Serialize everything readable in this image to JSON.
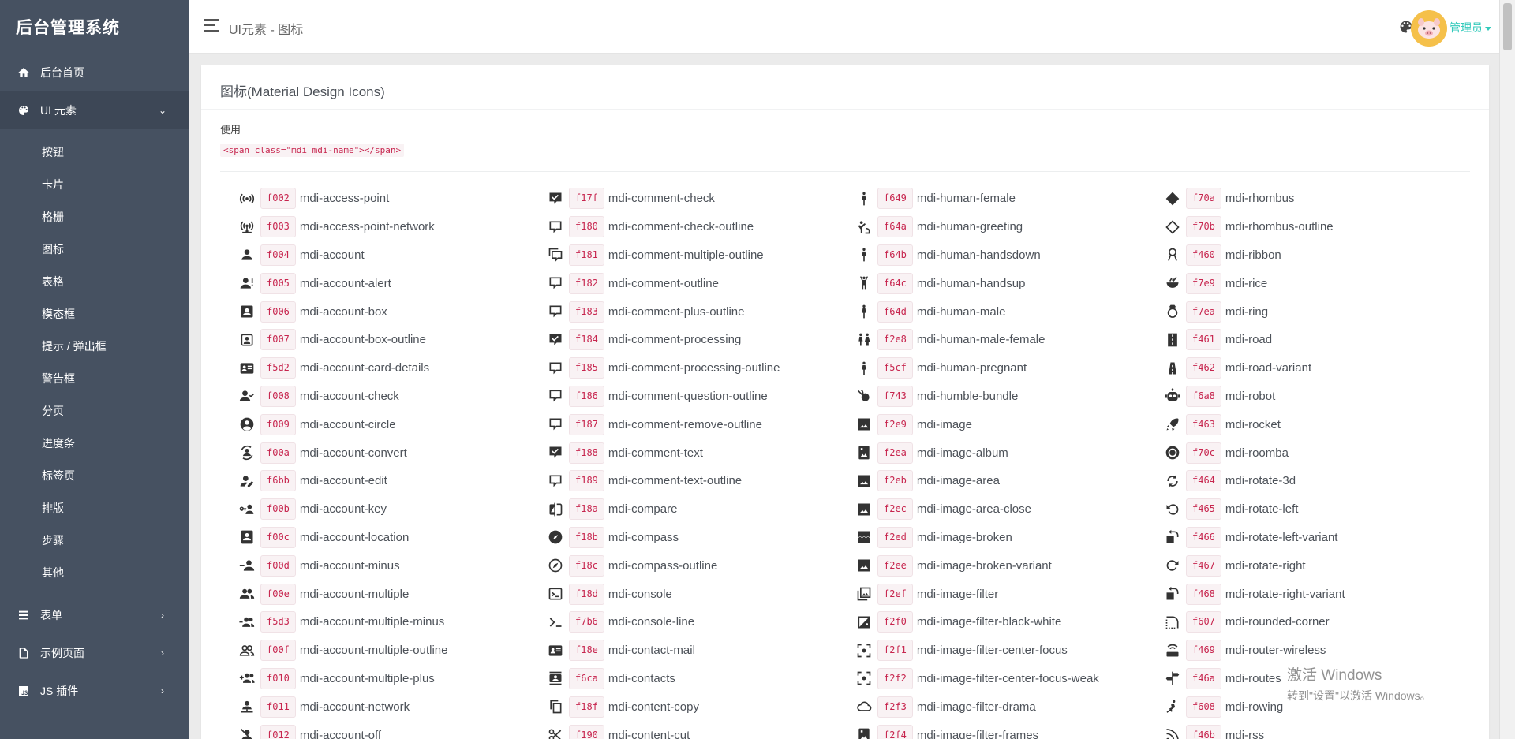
{
  "app": {
    "title": "后台管理系统"
  },
  "sidebar": {
    "top_items": [
      {
        "label": "后台首页",
        "icon": "home-icon"
      },
      {
        "label": "UI 元素",
        "icon": "palette-icon"
      }
    ],
    "sub_items": [
      "按钮",
      "卡片",
      "格栅",
      "图标",
      "表格",
      "模态框",
      "提示 / 弹出框",
      "警告框",
      "分页",
      "进度条",
      "标签页",
      "排版",
      "步骤",
      "其他"
    ],
    "bottom_items": [
      {
        "label": "表单",
        "icon": "format-list-icon"
      },
      {
        "label": "示例页面",
        "icon": "file-outline-icon"
      },
      {
        "label": "JS 插件",
        "icon": "language-javascript-icon"
      }
    ]
  },
  "header": {
    "title": "UI元素 - 图标",
    "user": "管理员"
  },
  "card": {
    "title": "图标(Material Design Icons)",
    "usage_label": "使用",
    "usage_code": "<span class=\"mdi mdi-name\"></span>"
  },
  "icon_columns": [
    [
      {
        "code": "f002",
        "name": "mdi-access-point",
        "g": "ap"
      },
      {
        "code": "f003",
        "name": "mdi-access-point-network",
        "g": "apn"
      },
      {
        "code": "f004",
        "name": "mdi-account",
        "g": "acc"
      },
      {
        "code": "f005",
        "name": "mdi-account-alert",
        "g": "acca"
      },
      {
        "code": "f006",
        "name": "mdi-account-box",
        "g": "accb"
      },
      {
        "code": "f007",
        "name": "mdi-account-box-outline",
        "g": "accbo"
      },
      {
        "code": "f5d2",
        "name": "mdi-account-card-details",
        "g": "card"
      },
      {
        "code": "f008",
        "name": "mdi-account-check",
        "g": "accc"
      },
      {
        "code": "f009",
        "name": "mdi-account-circle",
        "g": "accci"
      },
      {
        "code": "f00a",
        "name": "mdi-account-convert",
        "g": "conv"
      },
      {
        "code": "f6bb",
        "name": "mdi-account-edit",
        "g": "acce"
      },
      {
        "code": "f00b",
        "name": "mdi-account-key",
        "g": "acck"
      },
      {
        "code": "f00c",
        "name": "mdi-account-location",
        "g": "accl"
      },
      {
        "code": "f00d",
        "name": "mdi-account-minus",
        "g": "accm"
      },
      {
        "code": "f00e",
        "name": "mdi-account-multiple",
        "g": "mult"
      },
      {
        "code": "f5d3",
        "name": "mdi-account-multiple-minus",
        "g": "multm"
      },
      {
        "code": "f00f",
        "name": "mdi-account-multiple-outline",
        "g": "multo"
      },
      {
        "code": "f010",
        "name": "mdi-account-multiple-plus",
        "g": "multp"
      },
      {
        "code": "f011",
        "name": "mdi-account-network",
        "g": "accn"
      },
      {
        "code": "f012",
        "name": "mdi-account-off",
        "g": "acco"
      }
    ],
    [
      {
        "code": "f17f",
        "name": "mdi-comment-check",
        "g": "cmtf"
      },
      {
        "code": "f180",
        "name": "mdi-comment-check-outline",
        "g": "cmto"
      },
      {
        "code": "f181",
        "name": "mdi-comment-multiple-outline",
        "g": "cmtm"
      },
      {
        "code": "f182",
        "name": "mdi-comment-outline",
        "g": "cmto"
      },
      {
        "code": "f183",
        "name": "mdi-comment-plus-outline",
        "g": "cmto"
      },
      {
        "code": "f184",
        "name": "mdi-comment-processing",
        "g": "cmtf"
      },
      {
        "code": "f185",
        "name": "mdi-comment-processing-outline",
        "g": "cmto"
      },
      {
        "code": "f186",
        "name": "mdi-comment-question-outline",
        "g": "cmto"
      },
      {
        "code": "f187",
        "name": "mdi-comment-remove-outline",
        "g": "cmto"
      },
      {
        "code": "f188",
        "name": "mdi-comment-text",
        "g": "cmtf"
      },
      {
        "code": "f189",
        "name": "mdi-comment-text-outline",
        "g": "cmto"
      },
      {
        "code": "f18a",
        "name": "mdi-compare",
        "g": "cmp"
      },
      {
        "code": "f18b",
        "name": "mdi-compass",
        "g": "cmps"
      },
      {
        "code": "f18c",
        "name": "mdi-compass-outline",
        "g": "cmpso"
      },
      {
        "code": "f18d",
        "name": "mdi-console",
        "g": "cons"
      },
      {
        "code": "f7b6",
        "name": "mdi-console-line",
        "g": "consl"
      },
      {
        "code": "f18e",
        "name": "mdi-contact-mail",
        "g": "card"
      },
      {
        "code": "f6ca",
        "name": "mdi-contacts",
        "g": "contacts"
      },
      {
        "code": "f18f",
        "name": "mdi-content-copy",
        "g": "copy"
      },
      {
        "code": "f190",
        "name": "mdi-content-cut",
        "g": "cut"
      }
    ],
    [
      {
        "code": "f649",
        "name": "mdi-human-female",
        "g": "human"
      },
      {
        "code": "f64a",
        "name": "mdi-human-greeting",
        "g": "humang"
      },
      {
        "code": "f64b",
        "name": "mdi-human-handsdown",
        "g": "human"
      },
      {
        "code": "f64c",
        "name": "mdi-human-handsup",
        "g": "humanu"
      },
      {
        "code": "f64d",
        "name": "mdi-human-male",
        "g": "human"
      },
      {
        "code": "f2e8",
        "name": "mdi-human-male-female",
        "g": "humanmf"
      },
      {
        "code": "f5cf",
        "name": "mdi-human-pregnant",
        "g": "human"
      },
      {
        "code": "f743",
        "name": "mdi-humble-bundle",
        "g": "humble"
      },
      {
        "code": "f2e9",
        "name": "mdi-image",
        "g": "img"
      },
      {
        "code": "f2ea",
        "name": "mdi-image-album",
        "g": "imgal"
      },
      {
        "code": "f2eb",
        "name": "mdi-image-area",
        "g": "img"
      },
      {
        "code": "f2ec",
        "name": "mdi-image-area-close",
        "g": "img"
      },
      {
        "code": "f2ed",
        "name": "mdi-image-broken",
        "g": "imgbr"
      },
      {
        "code": "f2ee",
        "name": "mdi-image-broken-variant",
        "g": "img"
      },
      {
        "code": "f2ef",
        "name": "mdi-image-filter",
        "g": "imgf"
      },
      {
        "code": "f2f0",
        "name": "mdi-image-filter-black-white",
        "g": "imgbw"
      },
      {
        "code": "f2f1",
        "name": "mdi-image-filter-center-focus",
        "g": "focus"
      },
      {
        "code": "f2f2",
        "name": "mdi-image-filter-center-focus-weak",
        "g": "focus"
      },
      {
        "code": "f2f3",
        "name": "mdi-image-filter-drama",
        "g": "cloud"
      },
      {
        "code": "f2f4",
        "name": "mdi-image-filter-frames",
        "g": "imgal"
      }
    ],
    [
      {
        "code": "f70a",
        "name": "mdi-rhombus",
        "g": "rh"
      },
      {
        "code": "f70b",
        "name": "mdi-rhombus-outline",
        "g": "rho"
      },
      {
        "code": "f460",
        "name": "mdi-ribbon",
        "g": "ribbon"
      },
      {
        "code": "f7e9",
        "name": "mdi-rice",
        "g": "rice"
      },
      {
        "code": "f7ea",
        "name": "mdi-ring",
        "g": "ring"
      },
      {
        "code": "f461",
        "name": "mdi-road",
        "g": "road"
      },
      {
        "code": "f462",
        "name": "mdi-road-variant",
        "g": "roadv"
      },
      {
        "code": "f6a8",
        "name": "mdi-robot",
        "g": "robot"
      },
      {
        "code": "f463",
        "name": "mdi-rocket",
        "g": "rocket"
      },
      {
        "code": "f70c",
        "name": "mdi-roomba",
        "g": "roomba"
      },
      {
        "code": "f464",
        "name": "mdi-rotate-3d",
        "g": "rot3d"
      },
      {
        "code": "f465",
        "name": "mdi-rotate-left",
        "g": "rotl"
      },
      {
        "code": "f466",
        "name": "mdi-rotate-left-variant",
        "g": "rotlv"
      },
      {
        "code": "f467",
        "name": "mdi-rotate-right",
        "g": "rotr"
      },
      {
        "code": "f468",
        "name": "mdi-rotate-right-variant",
        "g": "rotlv"
      },
      {
        "code": "f607",
        "name": "mdi-rounded-corner",
        "g": "corner"
      },
      {
        "code": "f469",
        "name": "mdi-router-wireless",
        "g": "router"
      },
      {
        "code": "f46a",
        "name": "mdi-routes",
        "g": "routes"
      },
      {
        "code": "f608",
        "name": "mdi-rowing",
        "g": "rowing"
      },
      {
        "code": "f46b",
        "name": "mdi-rss",
        "g": "rss"
      }
    ]
  ],
  "watermark": {
    "title": "激活 Windows",
    "subtitle": "转到\"设置\"以激活 Windows。"
  }
}
